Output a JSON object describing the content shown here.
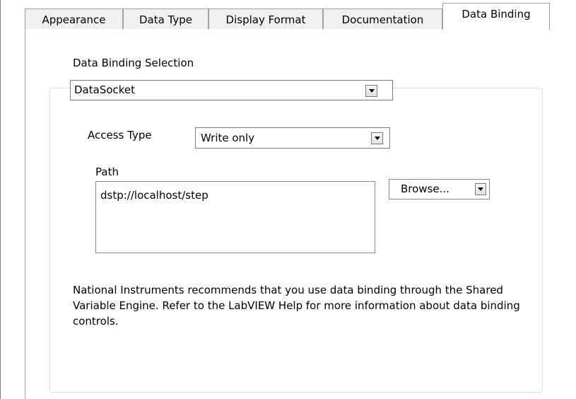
{
  "tabs": [
    {
      "label": "Appearance"
    },
    {
      "label": "Data Type"
    },
    {
      "label": "Display Format"
    },
    {
      "label": "Documentation"
    },
    {
      "label": "Data Binding"
    }
  ],
  "active_tab": "Data Binding",
  "data_binding": {
    "selection_label": "Data Binding Selection",
    "selection_value": "DataSocket",
    "access_type_label": "Access Type",
    "access_type_value": "Write only",
    "path_label": "Path",
    "path_value": "dstp://localhost/step",
    "browse_label": "Browse...",
    "note": "National Instruments recommends that you use data binding through the Shared Variable Engine.  Refer to the LabVIEW Help for more information about data binding controls."
  },
  "colors": {
    "tab_background": "#f0f0f0",
    "border": "#a0a0a0",
    "groupbox_border": "#d5dfe5"
  },
  "icons": {
    "dropdown": "chevron-down-icon"
  }
}
